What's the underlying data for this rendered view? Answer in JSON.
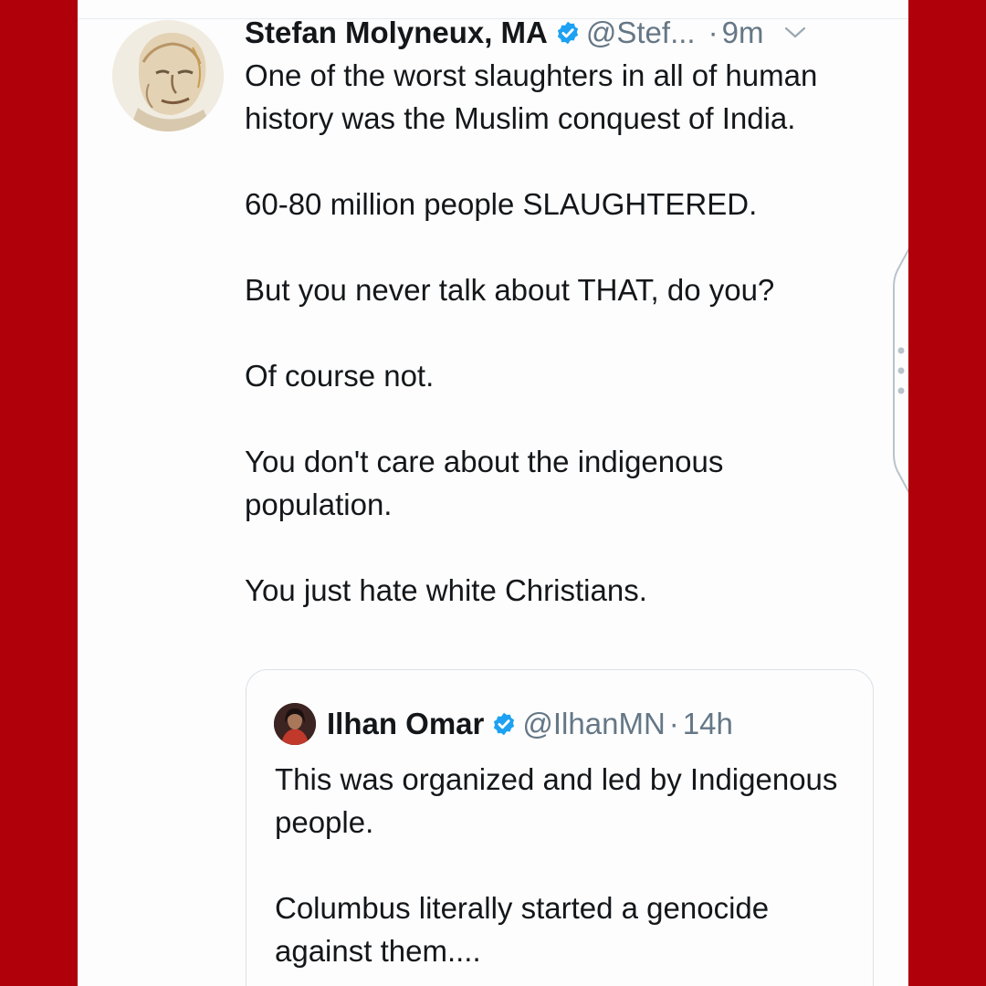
{
  "tweet": {
    "author_name": "Stefan Molyneux, MA",
    "handle": "@Stef...",
    "dot": "·",
    "time": "9m",
    "text": {
      "line1": "One of the worst slaughters in all of human history was the Muslim conquest of India.",
      "line2": "60-80 million people SLAUGHTERED.",
      "line3": "But you never talk about THAT, do you?",
      "line4": "Of course not.",
      "line5": "You don't care about the indigenous population.",
      "line6": "You just hate white Christians."
    }
  },
  "quoted_tweet": {
    "author_name": "Ilhan Omar",
    "handle": "@IlhanMN",
    "dot": "·",
    "time": "14h",
    "text": {
      "line1": "This was organized and led by Indigenous people.",
      "line2": "Columbus literally started a genocide against them...."
    }
  },
  "icons": {
    "verified": "verified-badge-icon",
    "more": "chevron-down-icon"
  },
  "colors": {
    "frame": "#b00009",
    "verified": "#1da1f2",
    "muted_text": "#657786",
    "text": "#14171a",
    "background": "#fdfdfd"
  }
}
